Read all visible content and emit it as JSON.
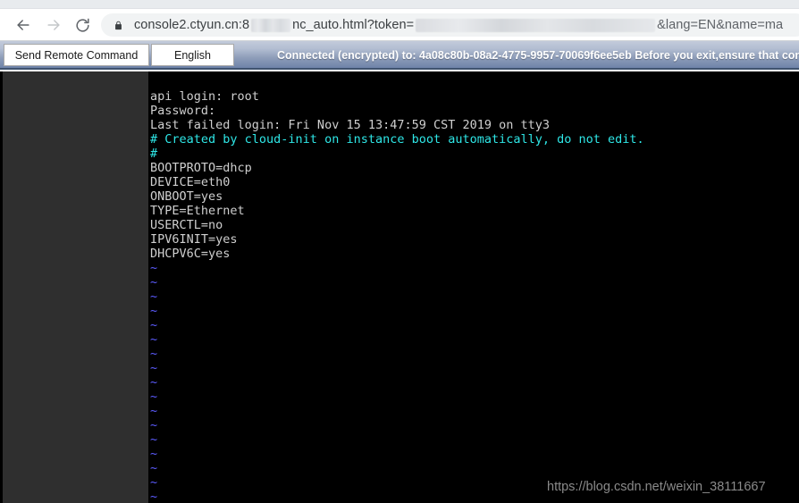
{
  "browser": {
    "nav": {
      "back_icon": "arrow-left-icon",
      "forward_icon": "arrow-right-icon",
      "reload_icon": "reload-icon"
    },
    "address_bar": {
      "lock_icon": "lock-icon",
      "url_prefix": "console2.ctyun.cn:8",
      "url_middle": "nc_auto.html?token=",
      "url_suffix": "&lang=EN&name=ma",
      "redacted_segments": [
        "port-redacted",
        "token-redacted"
      ]
    }
  },
  "vnc_toolbar": {
    "send_remote_command_label": "Send Remote Command",
    "language_label": "English",
    "status_text": "Connected (encrypted) to: 4a08c80b-08a2-4775-9957-70069f6ee5eb Before you exit,ensure that con"
  },
  "terminal": {
    "lines": [
      {
        "text": "api login: root",
        "color": "white"
      },
      {
        "text": "Password:",
        "color": "white"
      },
      {
        "text": "Last failed login: Fri Nov 15 13:47:59 CST 2019 on tty3",
        "color": "white"
      },
      {
        "text": "# Created by cloud-init on instance boot automatically, do not edit.",
        "color": "cyan"
      },
      {
        "text": "#",
        "color": "cyan"
      },
      {
        "text": "BOOTPROTO=dhcp",
        "color": "white"
      },
      {
        "text": "DEVICE=eth0",
        "color": "white"
      },
      {
        "text": "ONBOOT=yes",
        "color": "white"
      },
      {
        "text": "TYPE=Ethernet",
        "color": "white"
      },
      {
        "text": "USERCTL=no",
        "color": "white"
      },
      {
        "text": "IPV6INIT=yes",
        "color": "white"
      },
      {
        "text": "DHCPV6C=yes",
        "color": "white"
      },
      {
        "text": "~",
        "color": "blue"
      },
      {
        "text": "~",
        "color": "blue"
      },
      {
        "text": "~",
        "color": "blue"
      },
      {
        "text": "~",
        "color": "blue"
      },
      {
        "text": "~",
        "color": "blue"
      },
      {
        "text": "~",
        "color": "blue"
      },
      {
        "text": "~",
        "color": "blue"
      },
      {
        "text": "~",
        "color": "blue"
      },
      {
        "text": "~",
        "color": "blue"
      },
      {
        "text": "~",
        "color": "blue"
      },
      {
        "text": "~",
        "color": "blue"
      },
      {
        "text": "~",
        "color": "blue"
      },
      {
        "text": "~",
        "color": "blue"
      },
      {
        "text": "~",
        "color": "blue"
      },
      {
        "text": "~",
        "color": "blue"
      },
      {
        "text": "~",
        "color": "blue"
      },
      {
        "text": "~",
        "color": "blue"
      }
    ]
  },
  "watermark": {
    "text": "https://blog.csdn.net/weixin_38111667"
  },
  "colors": {
    "terminal_bg": "#000000",
    "gutter_bg": "#2f2f2f",
    "text_white": "#cfcfcf",
    "text_cyan": "#2ee6e6",
    "text_blue": "#5c5cff",
    "toolbar_top": "#c3cbdb",
    "toolbar_bottom": "#6e83a9"
  }
}
